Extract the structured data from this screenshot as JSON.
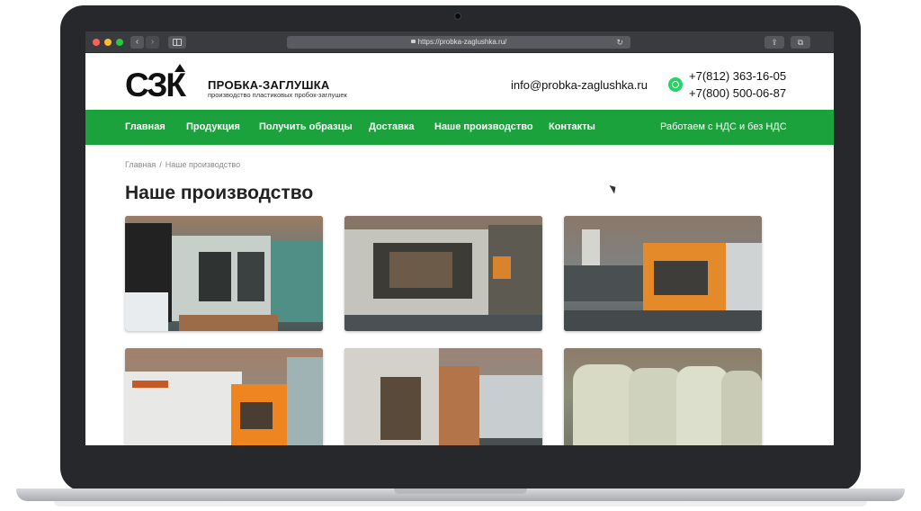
{
  "browser": {
    "url": "https://probka-zaglushka.ru/",
    "back_glyph": "‹",
    "forward_glyph": "›",
    "reload_glyph": "↻",
    "share_glyph": "⇪",
    "tabs_glyph": "⧉"
  },
  "header": {
    "logo_text": "СЗК",
    "brand_name": "ПРОБКА-ЗАГЛУШКА",
    "tagline": "производство пластиковых пробок-заглушек",
    "email": "info@probka-zaglushka.ru",
    "phone_1": "+7(812) 363-16-05",
    "phone_2": "+7(800) 500-06-87"
  },
  "nav": {
    "items": [
      {
        "label": "Главная"
      },
      {
        "label": "Продукция"
      },
      {
        "label": "Получить образцы"
      },
      {
        "label": "Доставка"
      },
      {
        "label": "Наше производство"
      },
      {
        "label": "Контакты"
      }
    ],
    "note": "Работаем с НДС и без НДС"
  },
  "breadcrumb": {
    "home": "Главная",
    "separator": "/",
    "current": "Наше производство"
  },
  "page": {
    "title": "Наше производство"
  },
  "colors": {
    "brand_green": "#1ba23c",
    "text_dark": "#222222",
    "laptop_bezel": "#26282c"
  }
}
